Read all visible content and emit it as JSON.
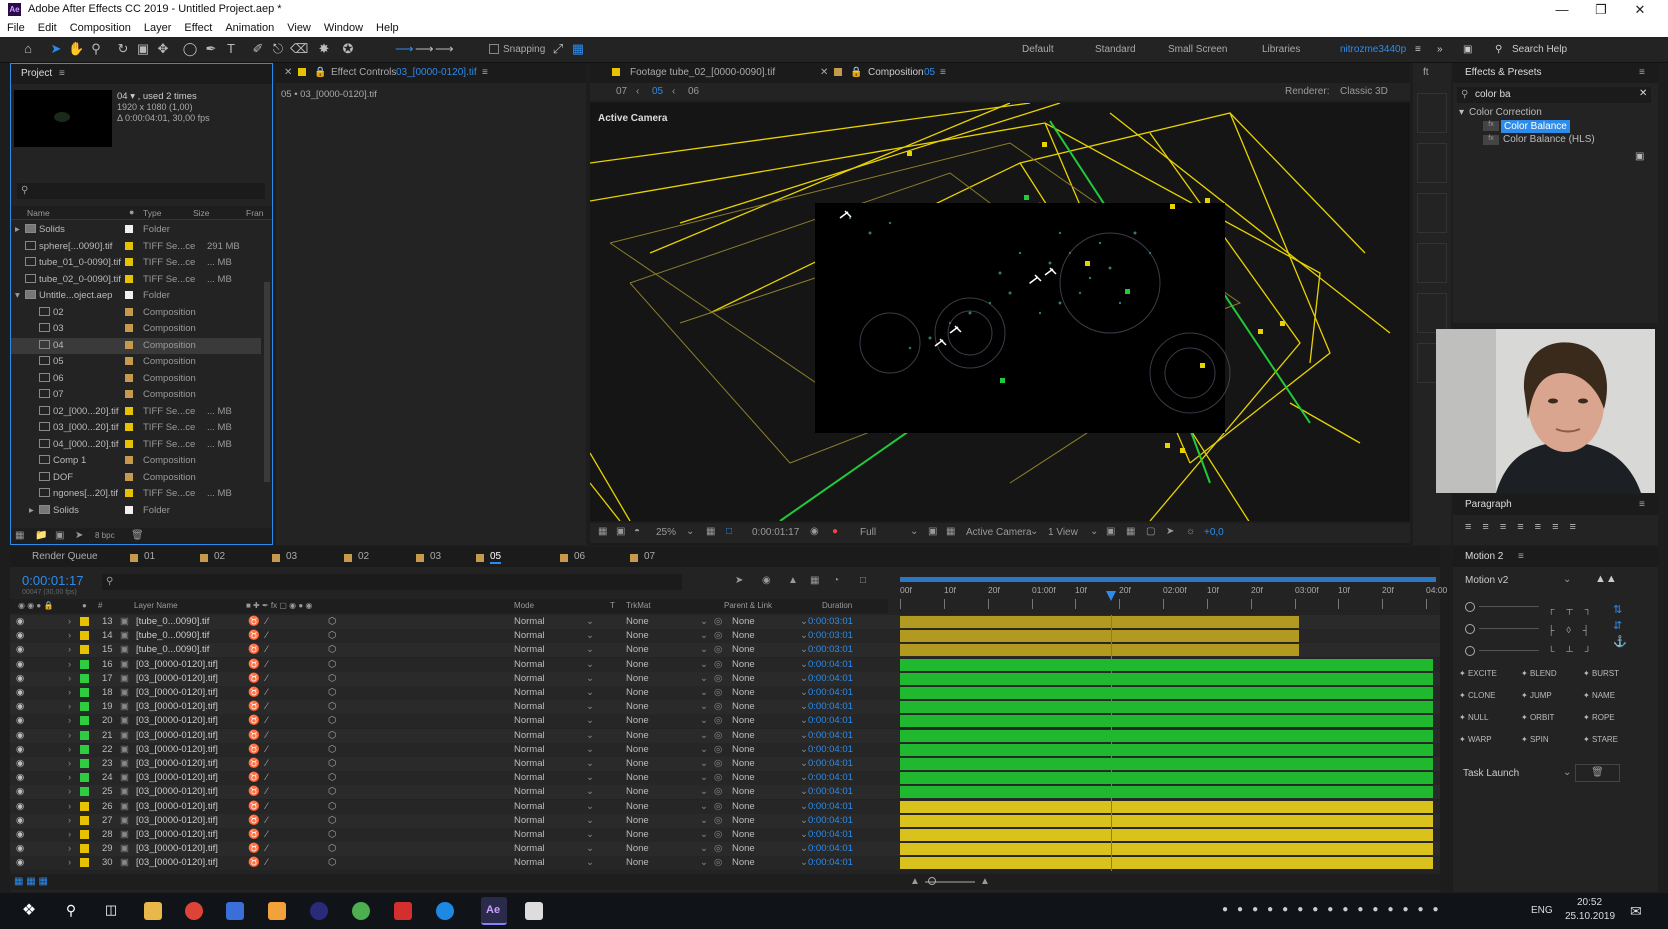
{
  "window": {
    "title": "Adobe After Effects CC 2019 - Untitled Project.aep *",
    "logo_text": "Ae"
  },
  "menu": [
    "File",
    "Edit",
    "Composition",
    "Layer",
    "Effect",
    "Animation",
    "View",
    "Window",
    "Help"
  ],
  "toolbar": {
    "snapping_label": "Snapping",
    "workspaces": [
      "Default",
      "Standard",
      "Small Screen",
      "Libraries"
    ],
    "active_workspace": "nitrozme3440p",
    "search_help": "Search Help"
  },
  "project": {
    "tab_label": "Project",
    "thumb_name": "04 ▾ , used 2 times",
    "thumb_res": "1920 x 1080 (1,00)",
    "thumb_dur": "Δ 0:00:04:01, 30,00 fps",
    "search_placeholder": "",
    "columns": [
      "Name",
      "Type",
      "Size",
      "Fran"
    ],
    "items": [
      {
        "name": "Solids",
        "type": "Folder",
        "size": "",
        "color": "#f0f0f0",
        "kind": "folder",
        "indent": 0
      },
      {
        "name": "sphere[...0090].tif",
        "type": "TIFF Se...ce",
        "size": "291 MB",
        "color": "#e6c200",
        "kind": "file",
        "indent": 0
      },
      {
        "name": "tube_01_0-0090].tif",
        "type": "TIFF Se...ce",
        "size": "... MB",
        "color": "#e6c200",
        "kind": "file",
        "indent": 0
      },
      {
        "name": "tube_02_0-0090].tif",
        "type": "TIFF Se...ce",
        "size": "... MB",
        "color": "#e6c200",
        "kind": "file",
        "indent": 0
      },
      {
        "name": "Untitle...oject.aep",
        "type": "Folder",
        "size": "",
        "color": "#f0f0f0",
        "kind": "folder",
        "indent": 0
      },
      {
        "name": "02",
        "type": "Composition",
        "size": "",
        "color": "#c59a4d",
        "kind": "comp",
        "indent": 1
      },
      {
        "name": "03",
        "type": "Composition",
        "size": "",
        "color": "#c59a4d",
        "kind": "comp",
        "indent": 1
      },
      {
        "name": "04",
        "type": "Composition",
        "size": "",
        "color": "#c59a4d",
        "kind": "comp",
        "indent": 1
      },
      {
        "name": "05",
        "type": "Composition",
        "size": "",
        "color": "#c59a4d",
        "kind": "comp",
        "indent": 1
      },
      {
        "name": "06",
        "type": "Composition",
        "size": "",
        "color": "#c59a4d",
        "kind": "comp",
        "indent": 1
      },
      {
        "name": "07",
        "type": "Composition",
        "size": "",
        "color": "#c59a4d",
        "kind": "comp",
        "indent": 1
      },
      {
        "name": "02_[000...20].tif",
        "type": "TIFF Se...ce",
        "size": "... MB",
        "color": "#e6c200",
        "kind": "file",
        "indent": 1
      },
      {
        "name": "03_[000...20].tif",
        "type": "TIFF Se...ce",
        "size": "... MB",
        "color": "#e6c200",
        "kind": "file",
        "indent": 1
      },
      {
        "name": "04_[000...20].tif",
        "type": "TIFF Se...ce",
        "size": "... MB",
        "color": "#e6c200",
        "kind": "file",
        "indent": 1
      },
      {
        "name": "Comp 1",
        "type": "Composition",
        "size": "",
        "color": "#c59a4d",
        "kind": "comp",
        "indent": 1
      },
      {
        "name": "DOF",
        "type": "Composition",
        "size": "",
        "color": "#c59a4d",
        "kind": "comp",
        "indent": 1
      },
      {
        "name": "ngones[...20].tif",
        "type": "TIFF Se...ce",
        "size": "... MB",
        "color": "#e6c200",
        "kind": "file",
        "indent": 1
      },
      {
        "name": "Solids",
        "type": "Folder",
        "size": "",
        "color": "#f0f0f0",
        "kind": "folder",
        "indent": 1
      }
    ],
    "bpc": "8 bpc"
  },
  "effect_controls": {
    "tab_prefix": "Effect Controls",
    "tab_target": "03_[0000-0120].tif",
    "subtitle": "05 • 03_[0000-0120].tif"
  },
  "viewer": {
    "footage_tab": "Footage tube_02_[0000-0090].tif",
    "comp_tab_prefix": "Composition",
    "comp_tab_name": "05",
    "crumbs": [
      "07",
      "05",
      "06"
    ],
    "renderer_label": "Renderer:",
    "renderer_value": "Classic 3D",
    "camera_label": "Active Camera",
    "zoom": "25%",
    "timecode": "0:00:01:17",
    "resolution": "Full",
    "view_camera": "Active Camera",
    "view_count": "1 View",
    "exposure": "+0,0"
  },
  "effects": {
    "tab_label": "Effects & Presets",
    "search_value": "color ba",
    "category": "Color Correction",
    "items": [
      "Color Balance",
      "Color Balance (HLS)"
    ]
  },
  "paragraph": {
    "tab_label": "Paragraph"
  },
  "motion": {
    "tab_label": "Motion 2",
    "preset": "Motion v2",
    "buttons": [
      "EXCITE",
      "BLEND",
      "BURST",
      "CLONE",
      "JUMP",
      "NAME",
      "NULL",
      "ORBIT",
      "ROPE",
      "WARP",
      "SPIN",
      "STARE"
    ],
    "task": "Task Launch"
  },
  "timeline": {
    "render_queue": "Render Queue",
    "comp_tabs": [
      "01",
      "02",
      "03",
      "02",
      "03",
      "05",
      "06",
      "07"
    ],
    "active_tab": "05",
    "timecode": "0:00:01:17",
    "timecode_sub": "00047 (30,00 fps)",
    "columns": [
      "#",
      "Layer Name",
      "Mode",
      "T",
      "TrkMat",
      "Parent & Link",
      "Duration"
    ],
    "ruler": [
      "00f",
      "10f",
      "20f",
      "01:00f",
      "10f",
      "20f",
      "02:00f",
      "10f",
      "20f",
      "03:00f",
      "10f",
      "20f",
      "04:00"
    ],
    "playhead_fraction": 0.394,
    "layers": [
      {
        "num": "13",
        "name": "[tube_0...0090].tif",
        "mode": "Normal",
        "trkmat": "None",
        "parent": "None",
        "duration": "0:00:03:01",
        "color": "#e6c200",
        "bar": "olive",
        "bar_end": 0.745
      },
      {
        "num": "14",
        "name": "[tube_0...0090].tif",
        "mode": "Normal",
        "trkmat": "None",
        "parent": "None",
        "duration": "0:00:03:01",
        "color": "#e6c200",
        "bar": "olive",
        "bar_end": 0.745
      },
      {
        "num": "15",
        "name": "[tube_0...0090].tif",
        "mode": "Normal",
        "trkmat": "None",
        "parent": "None",
        "duration": "0:00:03:01",
        "color": "#e6c200",
        "bar": "olive",
        "bar_end": 0.745
      },
      {
        "num": "16",
        "name": "[03_[0000-0120].tif]",
        "mode": "Normal",
        "trkmat": "None",
        "parent": "None",
        "duration": "0:00:04:01",
        "color": "#2ecc40",
        "bar": "green",
        "bar_end": 0.995
      },
      {
        "num": "17",
        "name": "[03_[0000-0120].tif]",
        "mode": "Normal",
        "trkmat": "None",
        "parent": "None",
        "duration": "0:00:04:01",
        "color": "#2ecc40",
        "bar": "green",
        "bar_end": 0.995
      },
      {
        "num": "18",
        "name": "[03_[0000-0120].tif]",
        "mode": "Normal",
        "trkmat": "None",
        "parent": "None",
        "duration": "0:00:04:01",
        "color": "#2ecc40",
        "bar": "green",
        "bar_end": 0.995
      },
      {
        "num": "19",
        "name": "[03_[0000-0120].tif]",
        "mode": "Normal",
        "trkmat": "None",
        "parent": "None",
        "duration": "0:00:04:01",
        "color": "#2ecc40",
        "bar": "green",
        "bar_end": 0.995
      },
      {
        "num": "20",
        "name": "[03_[0000-0120].tif]",
        "mode": "Normal",
        "trkmat": "None",
        "parent": "None",
        "duration": "0:00:04:01",
        "color": "#2ecc40",
        "bar": "green",
        "bar_end": 0.995
      },
      {
        "num": "21",
        "name": "[03_[0000-0120].tif]",
        "mode": "Normal",
        "trkmat": "None",
        "parent": "None",
        "duration": "0:00:04:01",
        "color": "#2ecc40",
        "bar": "green",
        "bar_end": 0.995
      },
      {
        "num": "22",
        "name": "[03_[0000-0120].tif]",
        "mode": "Normal",
        "trkmat": "None",
        "parent": "None",
        "duration": "0:00:04:01",
        "color": "#2ecc40",
        "bar": "green",
        "bar_end": 0.995
      },
      {
        "num": "23",
        "name": "[03_[0000-0120].tif]",
        "mode": "Normal",
        "trkmat": "None",
        "parent": "None",
        "duration": "0:00:04:01",
        "color": "#2ecc40",
        "bar": "green",
        "bar_end": 0.995
      },
      {
        "num": "24",
        "name": "[03_[0000-0120].tif]",
        "mode": "Normal",
        "trkmat": "None",
        "parent": "None",
        "duration": "0:00:04:01",
        "color": "#2ecc40",
        "bar": "green",
        "bar_end": 0.995
      },
      {
        "num": "25",
        "name": "[03_[0000-0120].tif]",
        "mode": "Normal",
        "trkmat": "None",
        "parent": "None",
        "duration": "0:00:04:01",
        "color": "#2ecc40",
        "bar": "green",
        "bar_end": 0.995
      },
      {
        "num": "26",
        "name": "[03_[0000-0120].tif]",
        "mode": "Normal",
        "trkmat": "None",
        "parent": "None",
        "duration": "0:00:04:01",
        "color": "#e6c200",
        "bar": "yellow",
        "bar_end": 0.995
      },
      {
        "num": "27",
        "name": "[03_[0000-0120].tif]",
        "mode": "Normal",
        "trkmat": "None",
        "parent": "None",
        "duration": "0:00:04:01",
        "color": "#e6c200",
        "bar": "yellow",
        "bar_end": 0.995
      },
      {
        "num": "28",
        "name": "[03_[0000-0120].tif]",
        "mode": "Normal",
        "trkmat": "None",
        "parent": "None",
        "duration": "0:00:04:01",
        "color": "#e6c200",
        "bar": "yellow",
        "bar_end": 0.995
      },
      {
        "num": "29",
        "name": "[03_[0000-0120].tif]",
        "mode": "Normal",
        "trkmat": "None",
        "parent": "None",
        "duration": "0:00:04:01",
        "color": "#e6c200",
        "bar": "yellow",
        "bar_end": 0.995
      },
      {
        "num": "30",
        "name": "[03_[0000-0120].tif]",
        "mode": "Normal",
        "trkmat": "None",
        "parent": "None",
        "duration": "0:00:04:01",
        "color": "#e6c200",
        "bar": "yellow",
        "bar_end": 0.995
      }
    ]
  },
  "taskbar": {
    "lang": "ENG",
    "time": "20:52",
    "date": "25.10.2019"
  },
  "colors": {
    "accent_blue": "#2d8ceb",
    "layer_green": "#1fb82f",
    "layer_yellow": "#d9c21b",
    "camera_yellow": "#e8d200",
    "camera_green": "#22c93a"
  }
}
